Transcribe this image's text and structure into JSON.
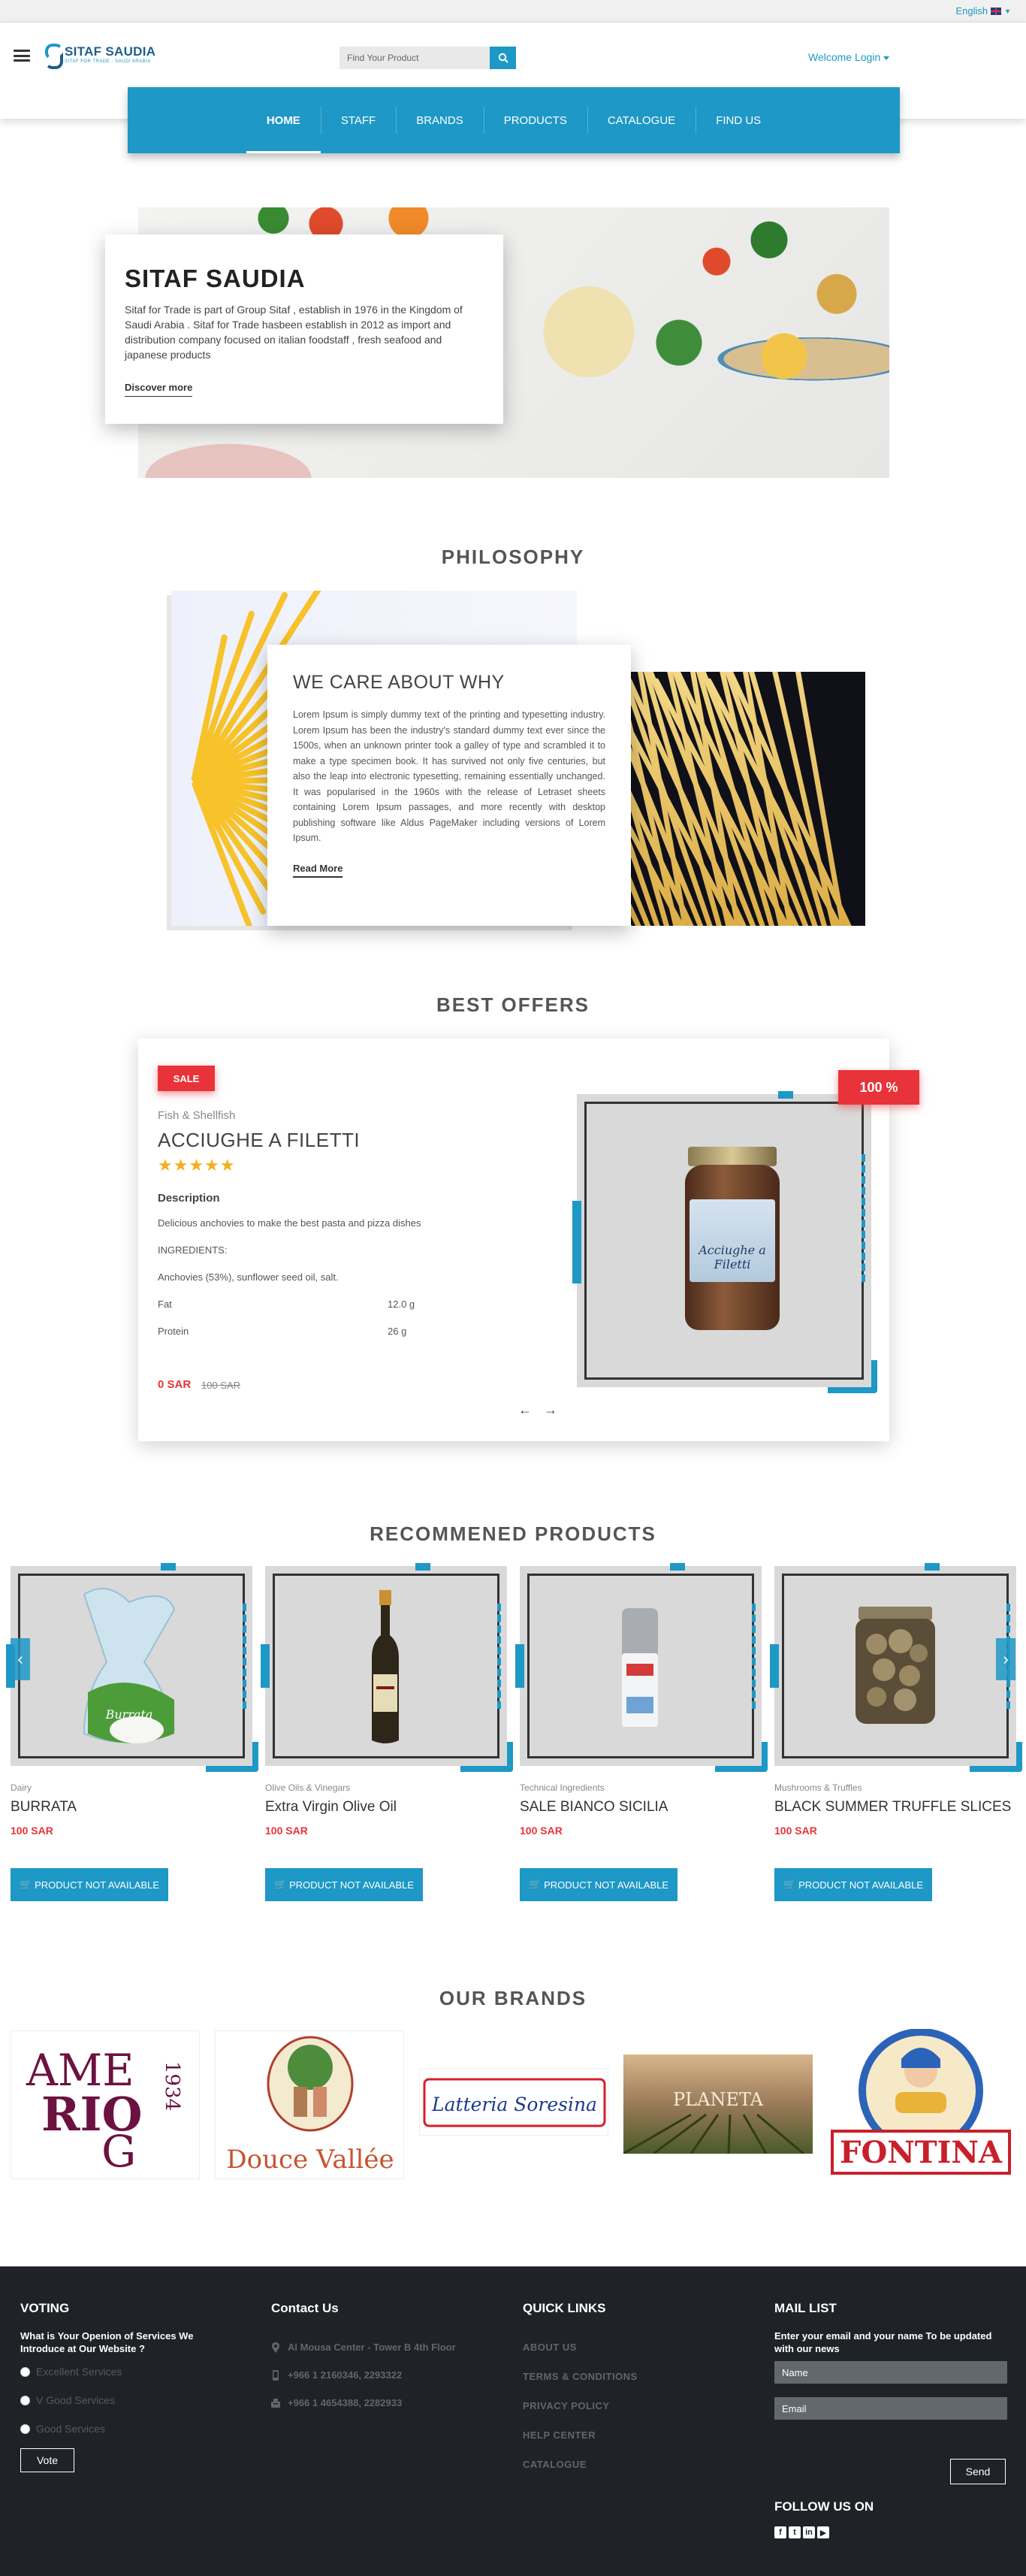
{
  "topbar": {
    "language": "English"
  },
  "header": {
    "logo_name": "SITAF SAUDIA",
    "logo_tagline": "SITAF FOR TRADE - SAUDI ARABIA",
    "search_placeholder": "Find Your Product",
    "welcome": "Welcome Login"
  },
  "nav": {
    "items": [
      {
        "label": "HOME",
        "active": true
      },
      {
        "label": "STAFF"
      },
      {
        "label": "BRANDS"
      },
      {
        "label": "PRODUCTS"
      },
      {
        "label": "CATALOGUE"
      },
      {
        "label": "FIND US"
      }
    ]
  },
  "hero": {
    "title": "SITAF SAUDIA",
    "description": "Sitaf for Trade is part of Group Sitaf , establish in 1976 in the Kingdom of Saudi Arabia . Sitaf for Trade hasbeen establish in 2012 as import and distribution company focused on italian foodstaff , fresh seafood and japanese products",
    "link": "Discover more"
  },
  "philosophy": {
    "section_title": "PHILOSOPHY",
    "card_title": "WE CARE ABOUT WHY",
    "text": "Lorem Ipsum is simply dummy text of the printing and typesetting industry. Lorem Ipsum has been the industry's standard dummy text ever since the 1500s, when an unknown printer took a galley of type and scrambled it to make a type specimen book. It has survived not only five centuries, but also the leap into electronic typesetting, remaining essentially unchanged. It was popularised in the 1960s with the release of Letraset sheets containing Lorem Ipsum passages, and more recently with desktop publishing software like Aldus PageMaker including versions of Lorem Ipsum.",
    "link": "Read More"
  },
  "offers": {
    "section_title": "BEST OFFERS",
    "sale_badge": "SALE",
    "discount_badge": "100 %",
    "category": "Fish & Shellfish",
    "name": "ACCIUGHE A FILETTI",
    "rating": 5,
    "stars": "★★★★★",
    "description_heading": "Description",
    "description": "Delicious anchovies to make the best pasta and pizza dishes",
    "ingredients_label": "INGREDIENTS:",
    "ingredients": "Anchovies (53%), sunflower seed oil, salt.",
    "nutrition": [
      {
        "label": "Fat",
        "value": "12.0 g"
      },
      {
        "label": "Protein",
        "value": "26 g"
      }
    ],
    "price": "0 SAR",
    "old_price": "100 SAR",
    "prev_arrow": "←",
    "next_arrow": "→",
    "jar_label": "Acciughe a Filetti"
  },
  "recommended": {
    "section_title": "RECOMMENED PRODUCTS",
    "prev": "‹",
    "next": "›",
    "items": [
      {
        "category": "Dairy",
        "name": "BURRATA",
        "price": "100 SAR",
        "button": "PRODUCT NOT AVAILABLE"
      },
      {
        "category": "Olive Oils & Vinegars",
        "name": "Extra Virgin Olive Oil",
        "price": "100 SAR",
        "button": "PRODUCT NOT AVAILABLE"
      },
      {
        "category": "Technical Ingredients",
        "name": "SALE BIANCO SICILIA",
        "price": "100 SAR",
        "button": "PRODUCT NOT AVAILABLE"
      },
      {
        "category": "Mushrooms & Truffles",
        "name": "BLACK SUMMER TRUFFLE SLICES",
        "price": "100 SAR",
        "button": "PRODUCT NOT AVAILABLE"
      }
    ]
  },
  "brands": {
    "section_title": "OUR BRANDS",
    "items": [
      {
        "name": "AMERIGO 1934",
        "logo_word1": "AME",
        "logo_word2": "RIO",
        "logo_word3": "G",
        "logo_year": "1934"
      },
      {
        "name": "Douce Vallée"
      },
      {
        "name": "Latteria Soresina"
      },
      {
        "name": "PLANETA"
      },
      {
        "name": "FONTINA"
      }
    ]
  },
  "footer": {
    "voting": {
      "title": "VOTING",
      "question": "What is Your Openion of Services We Introduce at Our Website ?",
      "options": [
        "Excellent Services",
        "V Good Services",
        "Good Services"
      ],
      "button": "Vote"
    },
    "contact": {
      "title": "Contact Us",
      "address": "Al Mousa Center - Tower B 4th Floor",
      "phone": "+966 1 2160346, 2293322",
      "fax": "+966 1 4654388, 2282933"
    },
    "quick_links": {
      "title": "QUICK LINKS",
      "items": [
        "ABOUT US",
        "TERMS & CONDITIONS",
        "PRIVACY POLICY",
        "HELP CENTER",
        "CATALOGUE"
      ]
    },
    "mail_list": {
      "title": "MAIL LIST",
      "text": "Enter your email and your name To be updated with our news",
      "name_placeholder": "Name",
      "email_placeholder": "Email",
      "button": "Send",
      "follow": "FOLLOW US ON",
      "socials": [
        "facebook-icon",
        "twitter-icon",
        "linkedin-icon",
        "youtube-icon"
      ]
    }
  },
  "colors": {
    "accent": "#1e98c6",
    "sale": "#e8333a",
    "footer_bg": "#1f2327"
  }
}
